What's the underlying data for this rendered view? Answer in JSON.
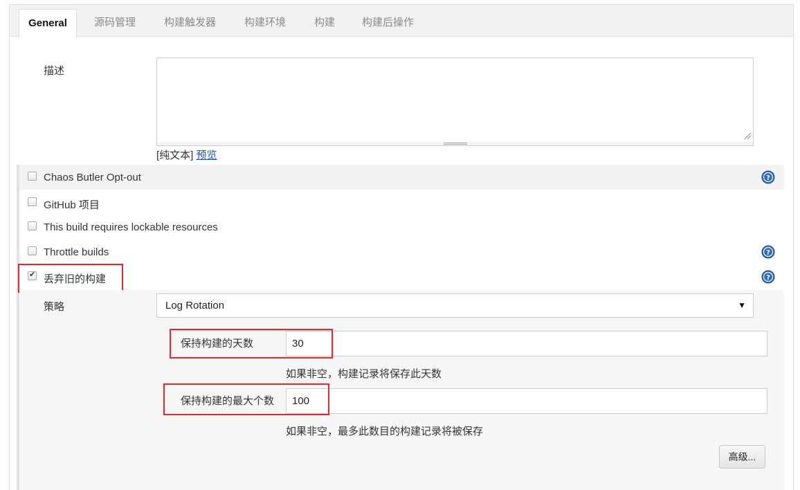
{
  "tabs": [
    {
      "label": "General",
      "active": true
    },
    {
      "label": "源码管理"
    },
    {
      "label": "构建触发器"
    },
    {
      "label": "构建环境"
    },
    {
      "label": "构建"
    },
    {
      "label": "构建后操作"
    }
  ],
  "description": {
    "label": "描述",
    "value": "",
    "format_plain": "[纯文本]",
    "format_preview": "预览"
  },
  "options": [
    {
      "label": "Chaos Butler Opt-out",
      "checked": false,
      "help": true
    },
    {
      "label": "GitHub 项目",
      "checked": false,
      "help": false
    },
    {
      "label": "This build requires lockable resources",
      "checked": false,
      "help": false
    },
    {
      "label": "Throttle builds",
      "checked": false,
      "help": true
    },
    {
      "label": "丢弃旧的构建",
      "checked": true,
      "help": true
    }
  ],
  "discard": {
    "strategy_label": "策略",
    "strategy_value": "Log Rotation",
    "days_label": "保持构建的天数",
    "days_value": "30",
    "days_hint": "如果非空，构建记录将保存此天数",
    "max_label": "保持构建的最大个数",
    "max_value": "100",
    "max_hint": "如果非空，最多此数目的构建记录将被保存",
    "advanced_label": "高级..."
  },
  "colors": {
    "highlight": "#e8242c",
    "help_icon": "#2e6cb5",
    "link": "#1f4fa8"
  }
}
